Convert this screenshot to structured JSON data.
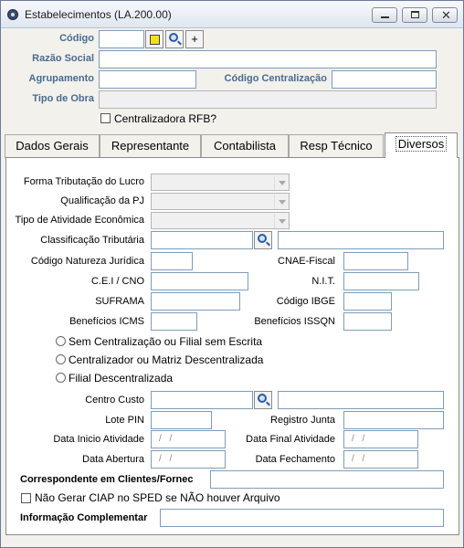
{
  "window": {
    "title": "Estabelecimentos (LA.200.00)",
    "buttons": {
      "minimize": "minimize-icon",
      "maximize": "maximize-icon",
      "close": "✕"
    }
  },
  "header": {
    "codigo_label": "Código",
    "codigo_value": "",
    "codigo_plus": "+",
    "razao_label": "Razão Social",
    "razao_value": "",
    "agrupamento_label": "Agrupamento",
    "agrupamento_value": "",
    "centralizacao_label": "Código Centralização",
    "centralizacao_value": "",
    "tipo_obra_label": "Tipo de Obra",
    "tipo_obra_value": "",
    "centralizadora_label": "Centralizadora RFB?"
  },
  "tabs": [
    {
      "label": "Dados Gerais"
    },
    {
      "label": "Representante"
    },
    {
      "label": "Contabilista"
    },
    {
      "label": "Resp Técnico"
    },
    {
      "label": "Diversos"
    }
  ],
  "active_tab": "Diversos",
  "diversos": {
    "forma_tributacao_label": "Forma Tributação do Lucro",
    "qualificacao_label": "Qualificação da PJ",
    "tipo_atividade_label": "Tipo de Atividade Econômica",
    "classificacao_label": "Classificação Tributária",
    "natureza_label": "Código Natureza Jurídica",
    "cnae_label": "CNAE-Fiscal",
    "cei_label": "C.E.I / CNO",
    "nit_label": "N.I.T.",
    "suframa_label": "SUFRAMA",
    "ibge_label": "Código IBGE",
    "icms_label": "Benefícios ICMS",
    "issqn_label": "Benefícios ISSQN",
    "radio_options": [
      "Sem Centralização ou Filial sem Escrita",
      "Centralizador ou Matriz Descentralizada",
      "Filial Descentralizada"
    ],
    "centro_custo_label": "Centro Custo",
    "lote_pin_label": "Lote PIN",
    "registro_junta_label": "Registro Junta",
    "data_inicio_label": "Data Inicio Atividade",
    "data_final_label": "Data Final Atividade",
    "data_abertura_label": "Data Abertura",
    "data_fechamento_label": "Data Fechamento",
    "date_placeholder": "/ /",
    "correspondente_label": "Correspondente em Clientes/Fornec",
    "nao_gerar_label": "Não Gerar CIAP no SPED se NÃO houver Arquivo",
    "info_complementar_label": "Informação Complementar"
  }
}
